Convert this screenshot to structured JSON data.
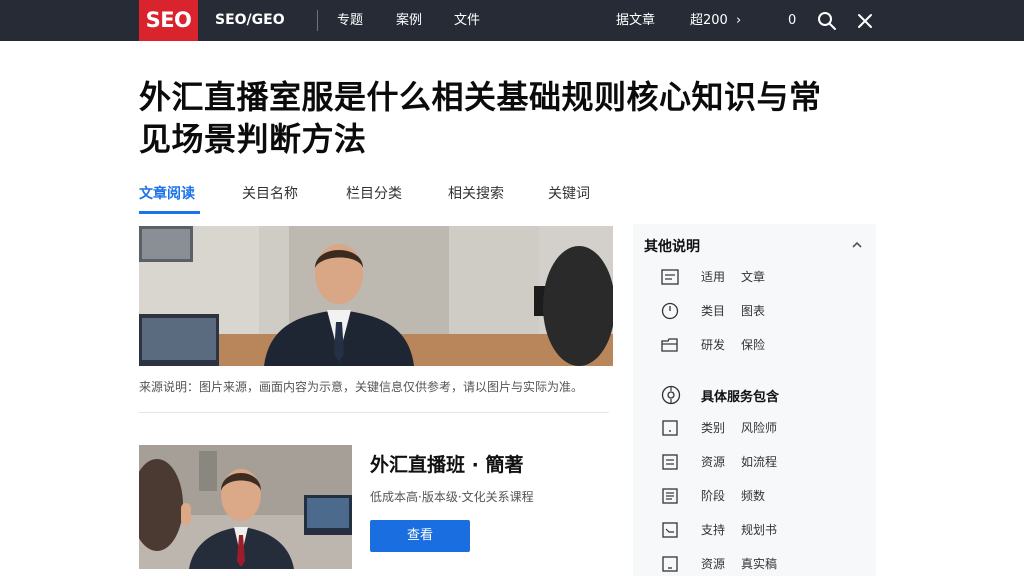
{
  "nav": {
    "logo": "SEO",
    "brand": "SEO/GEO",
    "links": [
      "专题",
      "案例",
      "文件"
    ],
    "right_link": "据文章",
    "counter": "超200",
    "count_small": "0",
    "icons": [
      "search-icon",
      "close-icon"
    ]
  },
  "article": {
    "title_line1": "外汇直播室服是什么相关基础规则核心知识与常",
    "title_line2": "见场景判断方法",
    "tabs": [
      "文章阅读",
      "关目名称",
      "栏目分类",
      "相关搜索",
      "关键词"
    ],
    "active_tab": 0,
    "caption": "来源说明：图片来源，画面内容为示意，关键信息仅供参考，请以图片与实际为准。",
    "card_title": "外汇直播班 · 簡著",
    "card_desc": "低成本高·版本级·文化关系课程",
    "card_button": "查看"
  },
  "sidebar": {
    "heading": "其他说明",
    "items_a": [
      {
        "icon": "document-icon",
        "a": "适用",
        "b": "文章"
      },
      {
        "icon": "clock-icon",
        "a": "类目",
        "b": "图表"
      },
      {
        "icon": "folder-icon",
        "a": "研发",
        "b": "保险"
      }
    ],
    "section2_heading": "具体服务包含",
    "section2_icon": "gear-icon",
    "items_b": [
      {
        "icon": "note-icon",
        "a": "类别",
        "b": "风险师"
      },
      {
        "icon": "list-icon",
        "a": "资源",
        "b": "如流程"
      },
      {
        "icon": "list-icon",
        "a": "阶段",
        "b": "频数"
      },
      {
        "icon": "tray-icon",
        "a": "支持",
        "b": "规划书"
      },
      {
        "icon": "note-icon",
        "a": "资源",
        "b": "真实稿"
      }
    ]
  },
  "colors": {
    "topbar": "#262b36",
    "logo_red": "#d9232d",
    "accent_blue": "#1a73e8",
    "button_blue": "#1a6ee0"
  }
}
